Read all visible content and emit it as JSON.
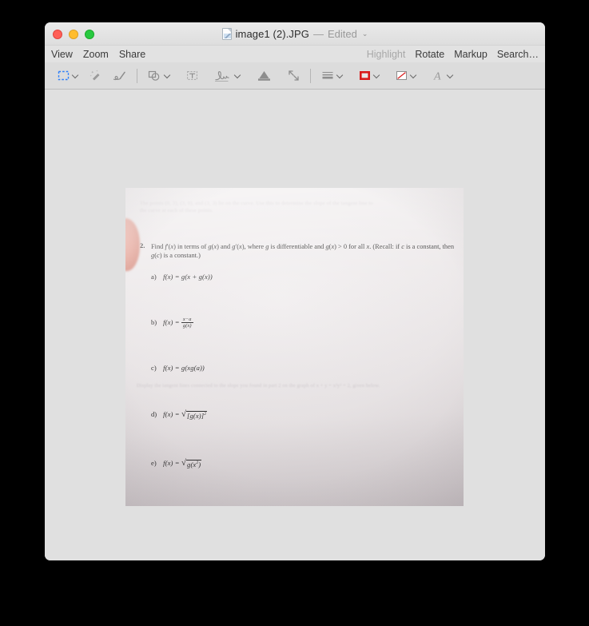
{
  "window": {
    "title": "image1 (2).JPG",
    "title_dash": "—",
    "edited_label": "Edited",
    "chevron": "⌄",
    "doc_icon": "jpeg-document-icon",
    "traffic_lights": [
      {
        "name": "close",
        "color": "#ff5f57"
      },
      {
        "name": "minimize",
        "color": "#ffbd2e"
      },
      {
        "name": "zoom",
        "color": "#28c940"
      }
    ]
  },
  "menubar": {
    "left_items": [
      {
        "label": "View",
        "dim": false
      },
      {
        "label": "Zoom",
        "dim": false
      },
      {
        "label": "Share",
        "dim": false
      }
    ],
    "right_items": [
      {
        "label": "Highlight",
        "dim": true
      },
      {
        "label": "Rotate",
        "dim": false
      },
      {
        "label": "Markup",
        "dim": false
      },
      {
        "label": "Search…",
        "dim": false
      }
    ]
  },
  "toolbar": {
    "items": [
      {
        "name": "rectangular-selection-icon",
        "has_chevron": true
      },
      {
        "name": "instant-alpha-icon",
        "has_chevron": false
      },
      {
        "name": "sketch-icon",
        "has_chevron": false
      },
      {
        "name": "shapes-icon",
        "has_chevron": true
      },
      {
        "name": "text-icon",
        "has_chevron": false
      },
      {
        "name": "signature-icon",
        "has_chevron": true
      },
      {
        "name": "adjust-color-icon",
        "has_chevron": false
      },
      {
        "name": "adjust-size-icon",
        "has_chevron": false
      },
      {
        "name": "shape-style-icon",
        "has_chevron": true
      },
      {
        "name": "border-color-icon",
        "has_chevron": true
      },
      {
        "name": "fill-color-icon",
        "has_chevron": true
      },
      {
        "name": "text-style-icon",
        "has_chevron": true
      }
    ],
    "accent_color": "#d91b1b",
    "selection_color": "#2d7ff9"
  },
  "document": {
    "faded_top_line_1": "The points (0, 3), (3, 0), and (3, 3) lie on the curve. Use this to determine the slope of the tangent line to",
    "faded_top_line_2": "the curve at each of these points.",
    "faded_mid_line": "Display the tangent lines connected to the slope you found in part 2 on the graph of x + y = x²y² = 2, given below.",
    "question_number": "2.",
    "question_text": "Find f′(x) in terms of g(x) and g′(x), where g is differentiable and g(x) > 0 for all x. (Recall: if c is a constant, then g(c) is a constant.)",
    "choices": [
      {
        "label": "a)",
        "formula": "f(x) = g(x + g(x))",
        "kind": "plain"
      },
      {
        "label": "b)",
        "formula": "f(x) = (x − a) / g(x)",
        "kind": "fraction",
        "numerator": "x − a",
        "denominator": "g(x)"
      },
      {
        "label": "c)",
        "formula": "f(x) = g(xg(a))",
        "kind": "plain"
      },
      {
        "label": "d)",
        "formula": "f(x) = √([g(x)]²)",
        "kind": "radical",
        "radicand": "[g(x)]",
        "radicand_exponent": "2"
      },
      {
        "label": "e)",
        "formula": "f(x) = √(g(x²))",
        "kind": "radical",
        "radicand": "g(x",
        "radicand_exponent": "2"
      }
    ]
  }
}
